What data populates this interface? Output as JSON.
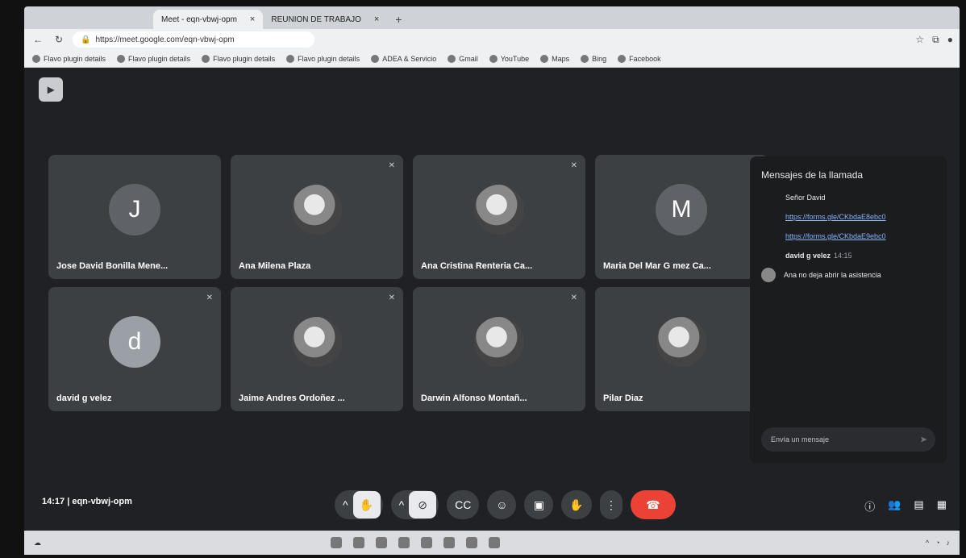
{
  "browser": {
    "tabs": [
      {
        "label": "Meet - eqn-vbwj-opm",
        "active": true
      },
      {
        "label": "REUNION DE TRABAJO",
        "active": false
      }
    ],
    "new_tab_symbol": "+",
    "close_symbol": "×",
    "url": "https://meet.google.com/eqn-vbwj-opm",
    "bookmarks": [
      "Flavo plugin details",
      "Flavo plugin details",
      "Flavo plugin details",
      "Flavo plugin details",
      "ADEA & Servicio",
      "Gmail",
      "YouTube",
      "Maps",
      "Bing",
      "Facebook"
    ]
  },
  "participants": [
    {
      "name": "Jose David Bonilla Mene...",
      "type": "letter",
      "letter": "J",
      "color": "#5f6368"
    },
    {
      "name": "Ana Milena Plaza",
      "type": "photo"
    },
    {
      "name": "Ana Cristina Renteria Ca...",
      "type": "photo"
    },
    {
      "name": "Maria Del Mar G mez Ca...",
      "type": "letter",
      "letter": "M",
      "color": "#5f6368"
    },
    {
      "name": "david g velez",
      "type": "letter",
      "letter": "d",
      "color": "#9aa0a6"
    },
    {
      "name": "Jaime Andres Ordoñez ...",
      "type": "photo"
    },
    {
      "name": "Darwin Alfonso Montañ...",
      "type": "photo"
    },
    {
      "name": "Pilar Diaz",
      "type": "photo"
    }
  ],
  "chat": {
    "title": "Mensajes de la llamada",
    "messages": [
      {
        "text": "Señor David",
        "link": false
      },
      {
        "text": "https://forms.gle/CKbdaE8ebc0",
        "link": true
      },
      {
        "text": "https://forms.gle/CKbdaE9ebc0",
        "link": true
      }
    ],
    "sender": "david g velez",
    "sender_time": "14:15",
    "last_message": "Ana no deja abrir la asistencia",
    "input_placeholder": "Envía un mensaje"
  },
  "meeting": {
    "time": "14:17",
    "separator": "|",
    "code": "eqn-vbwj-opm"
  },
  "controls": {
    "caret": "^",
    "captions_icon": "CC",
    "present_icon": "▣",
    "more_icon": "⋮",
    "end_icon": "☎"
  }
}
